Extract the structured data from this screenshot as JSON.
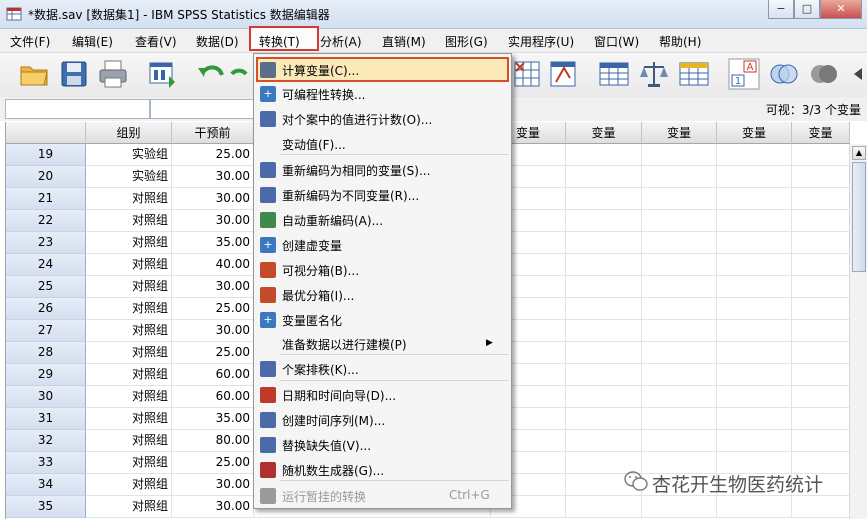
{
  "window": {
    "title": "*数据.sav [数据集1] - IBM SPSS Statistics 数据编辑器",
    "min_label": "−",
    "max_label": "□",
    "close_label": "✕"
  },
  "menubar": [
    {
      "label": "文件(F)"
    },
    {
      "label": "编辑(E)"
    },
    {
      "label": "查看(V)"
    },
    {
      "label": "数据(D)"
    },
    {
      "label": "转换(T)"
    },
    {
      "label": "分析(A)"
    },
    {
      "label": "直销(M)"
    },
    {
      "label": "图形(G)"
    },
    {
      "label": "实用程序(U)"
    },
    {
      "label": "窗口(W)"
    },
    {
      "label": "帮助(H)"
    }
  ],
  "toolbar_icons": [
    "open-folder-icon",
    "save-icon",
    "print-icon",
    "dialog-recall-icon",
    "undo-icon",
    "redo-icon",
    "goto-case-icon",
    "variables-icon",
    "split-file-icon",
    "weight-cases-icon",
    "value-labels-icon",
    "use-sets-icon",
    "show-sets-icon"
  ],
  "cell_editor": {
    "visible_text": "可视：3/3 个变量"
  },
  "grid": {
    "columns": [
      "组别",
      "干预前",
      "变量",
      "变量",
      "变量",
      "变量",
      "变量",
      "变量"
    ],
    "rows": [
      {
        "n": "19",
        "group": "实验组",
        "pre": "25.00"
      },
      {
        "n": "20",
        "group": "实验组",
        "pre": "30.00"
      },
      {
        "n": "21",
        "group": "对照组",
        "pre": "30.00"
      },
      {
        "n": "22",
        "group": "对照组",
        "pre": "30.00"
      },
      {
        "n": "23",
        "group": "对照组",
        "pre": "35.00"
      },
      {
        "n": "24",
        "group": "对照组",
        "pre": "40.00"
      },
      {
        "n": "25",
        "group": "对照组",
        "pre": "30.00"
      },
      {
        "n": "26",
        "group": "对照组",
        "pre": "25.00"
      },
      {
        "n": "27",
        "group": "对照组",
        "pre": "30.00"
      },
      {
        "n": "28",
        "group": "对照组",
        "pre": "25.00"
      },
      {
        "n": "29",
        "group": "对照组",
        "pre": "60.00"
      },
      {
        "n": "30",
        "group": "对照组",
        "pre": "60.00"
      },
      {
        "n": "31",
        "group": "对照组",
        "pre": "35.00"
      },
      {
        "n": "32",
        "group": "对照组",
        "pre": "80.00"
      },
      {
        "n": "33",
        "group": "对照组",
        "pre": "25.00"
      },
      {
        "n": "34",
        "group": "对照组",
        "pre": "30.00"
      },
      {
        "n": "35",
        "group": "对照组",
        "pre": "30.00"
      }
    ]
  },
  "transform_menu": {
    "items": [
      {
        "label": "计算变量(C)...",
        "icon": "calculator-icon",
        "color": "#5b6e8c"
      },
      {
        "label": "可编程性转换...",
        "icon": "plus-icon",
        "color": "#3a78c0"
      },
      {
        "label": "对个案中的值进行计数(O)...",
        "icon": "count-icon",
        "color": "#4a6aa8"
      },
      {
        "label": "变动值(F)...",
        "icon": "",
        "color": ""
      },
      {
        "label": "重新编码为相同的变量(S)...",
        "icon": "recode-same-icon",
        "color": "#4a6aa8"
      },
      {
        "label": "重新编码为不同变量(R)...",
        "icon": "recode-different-icon",
        "color": "#4a6aa8"
      },
      {
        "label": "自动重新编码(A)...",
        "icon": "auto-recode-icon",
        "color": "#3f8a4a"
      },
      {
        "label": "创建虚变量",
        "icon": "plus-icon",
        "color": "#3a78c0"
      },
      {
        "label": "可视分箱(B)...",
        "icon": "visual-binning-icon",
        "color": "#c44a2a"
      },
      {
        "label": "最优分箱(I)...",
        "icon": "optimal-binning-icon",
        "color": "#c44a2a"
      },
      {
        "label": "变量匿名化",
        "icon": "plus-icon",
        "color": "#3a78c0"
      },
      {
        "label": "准备数据以进行建模(P)",
        "icon": "",
        "color": "",
        "submenu_arrow": "▶"
      },
      {
        "label": "个案排秩(K)...",
        "icon": "rank-cases-icon",
        "color": "#4a6aa8"
      },
      {
        "label": "日期和时间向导(D)...",
        "icon": "date-time-icon",
        "color": "#c0392b"
      },
      {
        "label": "创建时间序列(M)...",
        "icon": "time-series-icon",
        "color": "#4a6aa8"
      },
      {
        "label": "替换缺失值(V)...",
        "icon": "replace-missing-icon",
        "color": "#4a6aa8"
      },
      {
        "label": "随机数生成器(G)...",
        "icon": "dice-icon",
        "color": "#b03030"
      },
      {
        "label": "运行暂挂的转换",
        "icon": "run-pending-icon",
        "color": "#9a9a9a",
        "shortcut": "Ctrl+G",
        "disabled": true
      }
    ]
  },
  "watermark": {
    "text": "杏花开生物医药统计"
  }
}
